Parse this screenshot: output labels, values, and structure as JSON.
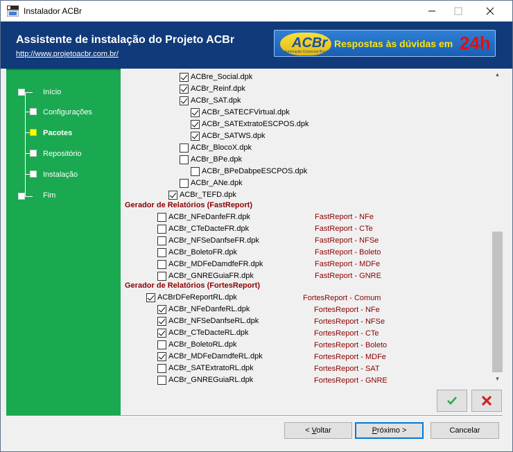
{
  "window": {
    "title": "Instalador ACBr"
  },
  "header": {
    "title": "Assistente de instalação do Projeto ACBr",
    "link": "http://www.projetoacbr.com.br/",
    "banner": {
      "logo": "ACBr",
      "logo_sub": "Automação Comercial Brasil",
      "text": "Respostas às dúvidas em",
      "highlight": "24h"
    }
  },
  "steps": [
    {
      "label": "Início",
      "active": false
    },
    {
      "label": "Configurações",
      "active": false
    },
    {
      "label": "Pacotes",
      "active": true
    },
    {
      "label": "Repositório",
      "active": false
    },
    {
      "label": "Instalação",
      "active": false
    },
    {
      "label": "Fim",
      "active": false
    }
  ],
  "packages": {
    "top_list": [
      {
        "name": "ACBre_Social.dpk",
        "checked": true
      },
      {
        "name": "ACBr_Reinf.dpk",
        "checked": true
      },
      {
        "name": "ACBr_SAT.dpk",
        "checked": true
      },
      {
        "name": "ACBr_SATECFVirtual.dpk",
        "checked": true
      },
      {
        "name": "ACBr_SATExtratoESCPOS.dpk",
        "checked": true
      },
      {
        "name": "ACBr_SATWS.dpk",
        "checked": true
      },
      {
        "name": "ACBr_BlocoX.dpk",
        "checked": false
      },
      {
        "name": "ACBr_BPe.dpk",
        "checked": false
      },
      {
        "name": "ACBr_BPeDabpeESCPOS.dpk",
        "checked": false
      },
      {
        "name": "ACBr_ANe.dpk",
        "checked": false
      },
      {
        "name": "ACBr_TEFD.dpk",
        "checked": true
      }
    ],
    "fastreport": {
      "heading": "Gerador de Relatórios (FastReport)",
      "items": [
        {
          "name": "ACBr_NFeDanfeFR.dpk",
          "checked": false,
          "desc": "FastReport - NFe"
        },
        {
          "name": "ACBr_CTeDacteFR.dpk",
          "checked": false,
          "desc": "FastReport - CTe"
        },
        {
          "name": "ACBr_NFSeDanfseFR.dpk",
          "checked": false,
          "desc": "FastReport - NFSe"
        },
        {
          "name": "ACBr_BoletoFR.dpk",
          "checked": false,
          "desc": "FastReport - Boleto"
        },
        {
          "name": "ACBr_MDFeDamdfeFR.dpk",
          "checked": false,
          "desc": "FastReport - MDFe"
        },
        {
          "name": "ACBr_GNREGuiaFR.dpk",
          "checked": false,
          "desc": "FastReport - GNRE"
        }
      ]
    },
    "fortesreport": {
      "heading": "Gerador de Relatórios (FortesReport)",
      "root": {
        "name": "ACBrDFeReportRL.dpk",
        "checked": true,
        "desc": "FortesReport - Comum"
      },
      "items": [
        {
          "name": "ACBr_NFeDanfeRL.dpk",
          "checked": true,
          "desc": "FortesReport - NFe"
        },
        {
          "name": "ACBr_NFSeDanfseRL.dpk",
          "checked": true,
          "desc": "FortesReport - NFSe"
        },
        {
          "name": "ACBr_CTeDacteRL.dpk",
          "checked": true,
          "desc": "FortesReport - CTe"
        },
        {
          "name": "ACBr_BoletoRL.dpk",
          "checked": false,
          "desc": "FortesReport - Boleto"
        },
        {
          "name": "ACBr_MDFeDamdfeRL.dpk",
          "checked": true,
          "desc": "FortesReport - MDFe"
        },
        {
          "name": "ACBr_SATExtratoRL.dpk",
          "checked": false,
          "desc": "FortesReport - SAT"
        },
        {
          "name": "ACBr_GNREGuiaRL.dpk",
          "checked": false,
          "desc": "FortesReport - GNRE"
        }
      ]
    }
  },
  "buttons": {
    "back_prefix": "< ",
    "back_key": "V",
    "back_rest": "oltar",
    "next_prefix": "",
    "next_key": "P",
    "next_rest": "róximo >",
    "cancel": "Cancelar"
  },
  "colors": {
    "header_bg": "#103a7a",
    "steps_bg": "#1aa850",
    "active_step": "#ffff00",
    "group_text": "#8b0000",
    "ok_check": "#2ea84a",
    "cancel_x": "#d42020"
  },
  "icons": {
    "ok": "check-icon",
    "cancel": "x-icon",
    "scroll_up": "chevron-up-icon",
    "scroll_down": "chevron-down-icon"
  }
}
